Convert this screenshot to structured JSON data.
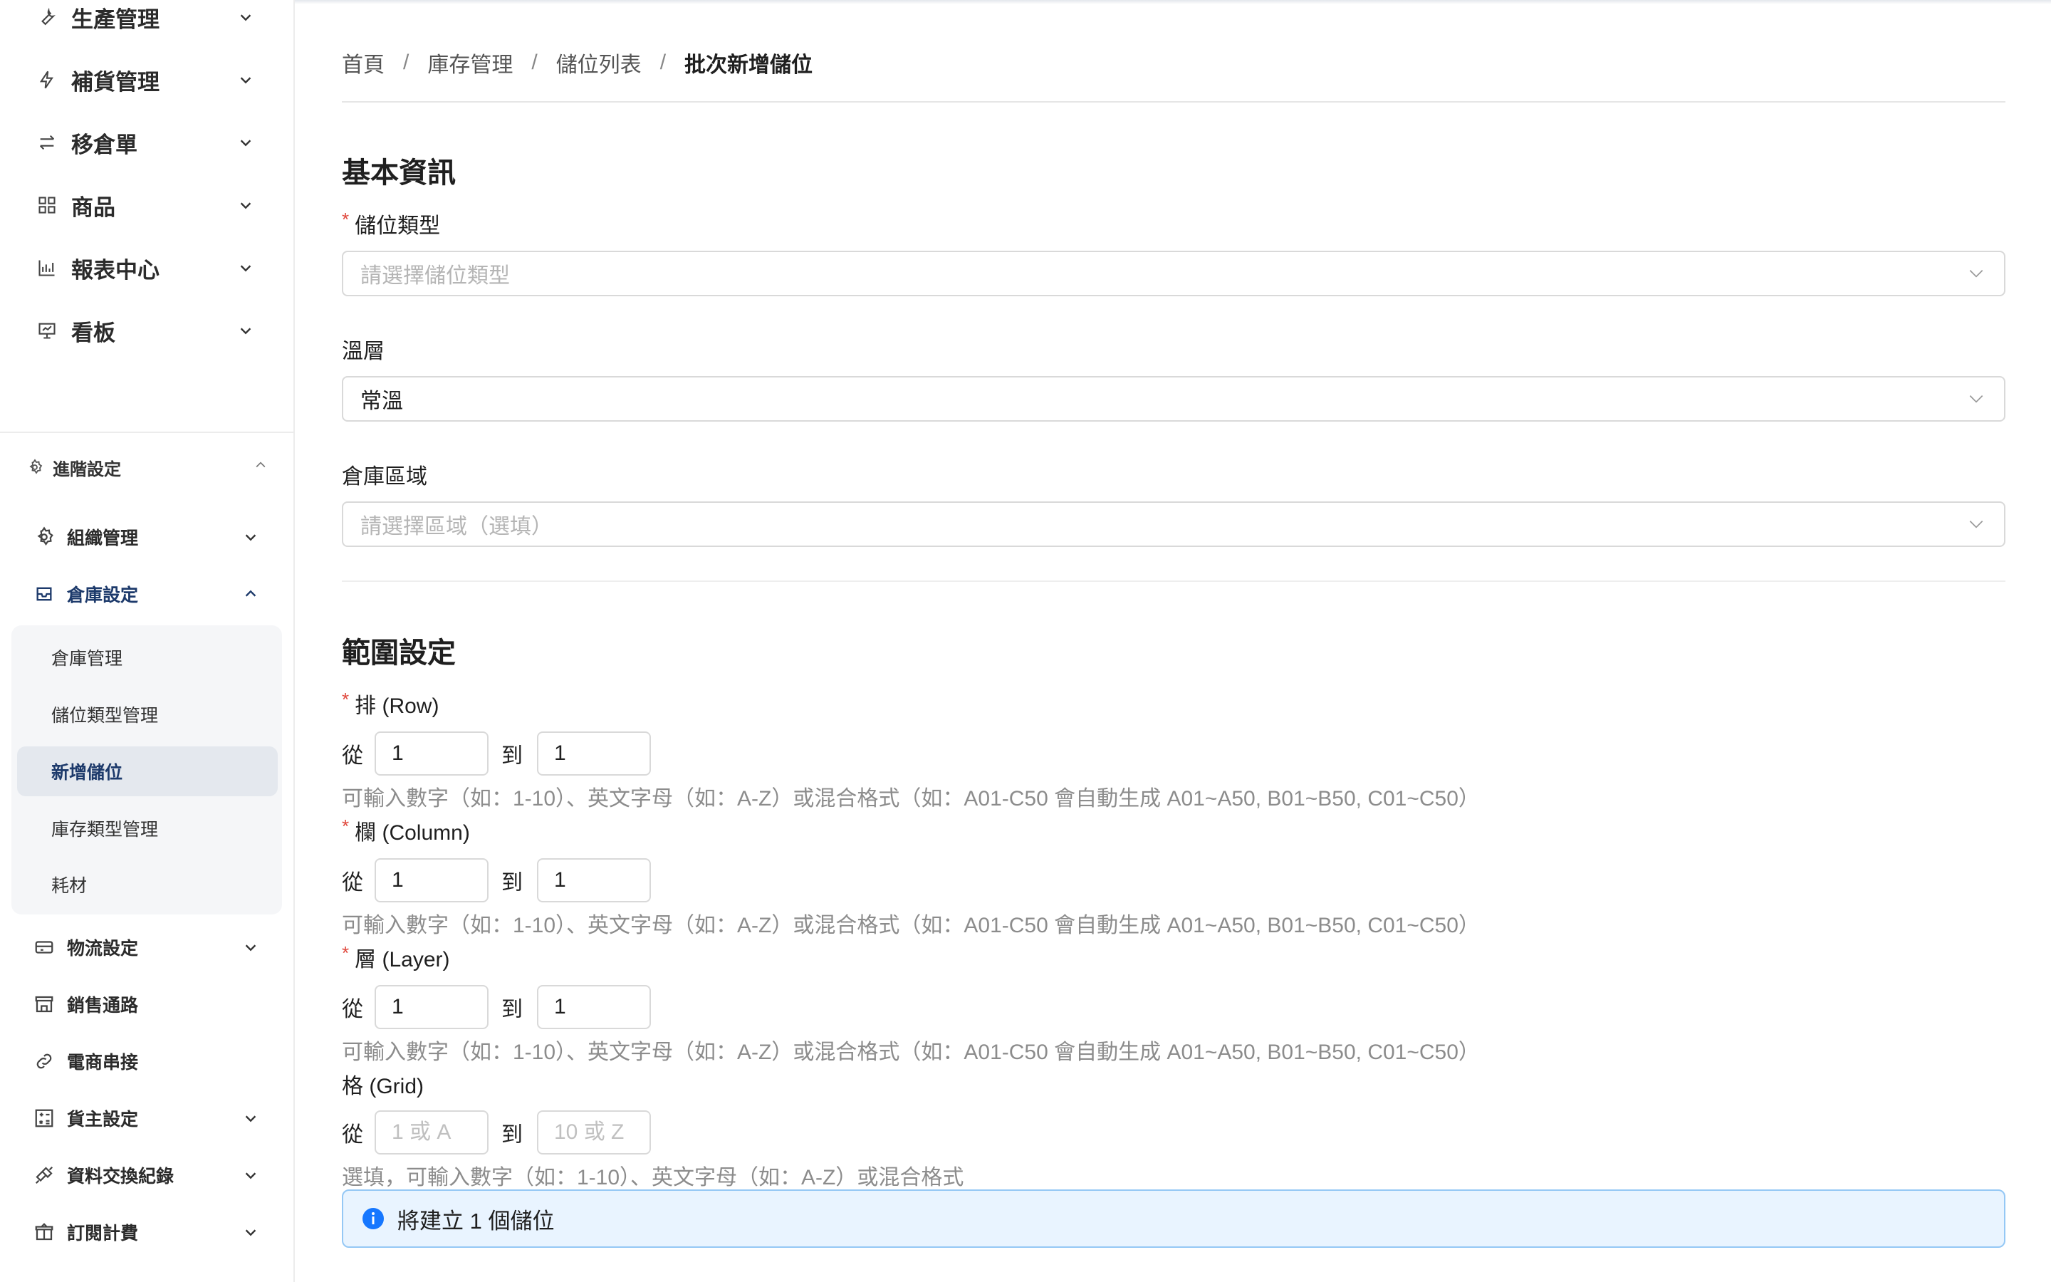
{
  "sidebar": {
    "top_items": [
      {
        "label": "生產管理",
        "icon": "wrench-icon"
      },
      {
        "label": "補貨管理",
        "icon": "lightning-icon"
      },
      {
        "label": "移倉單",
        "icon": "swap-icon"
      },
      {
        "label": "商品",
        "icon": "grid-icon"
      },
      {
        "label": "報表中心",
        "icon": "bar-chart-icon"
      },
      {
        "label": "看板",
        "icon": "presentation-icon"
      }
    ],
    "section": {
      "label": "進階設定",
      "icon": "gear-icon"
    },
    "section_items": [
      {
        "label": "組織管理",
        "icon": "gear-icon"
      },
      {
        "label": "倉庫設定",
        "icon": "inbox-icon"
      },
      {
        "label": "物流設定",
        "icon": "truck-icon"
      },
      {
        "label": "銷售通路",
        "icon": "shop-icon"
      },
      {
        "label": "電商串接",
        "icon": "link-icon"
      },
      {
        "label": "貨主設定",
        "icon": "calculator-icon"
      },
      {
        "label": "資料交換紀錄",
        "icon": "api-icon"
      },
      {
        "label": "訂閱計費",
        "icon": "gift-icon"
      }
    ],
    "warehouse_submenu": [
      {
        "label": "倉庫管理"
      },
      {
        "label": "儲位類型管理"
      },
      {
        "label": "新增儲位"
      },
      {
        "label": "庫存類型管理"
      },
      {
        "label": "耗材"
      }
    ]
  },
  "breadcrumb": {
    "items": [
      "首頁",
      "庫存管理",
      "儲位列表",
      "批次新增儲位"
    ],
    "separator": "/"
  },
  "basic_info": {
    "title": "基本資訊",
    "location_type": {
      "label": "儲位類型",
      "placeholder": "請選擇儲位類型"
    },
    "temperature": {
      "label": "溫層",
      "value": "常溫"
    },
    "zone": {
      "label": "倉庫區域",
      "placeholder": "請選擇區域（選填）"
    }
  },
  "range": {
    "title": "範圍設定",
    "from_label": "從",
    "to_label": "到",
    "hint": "可輸入數字（如：1-10）、英文字母（如：A-Z）或混合格式（如：A01-C50 會自動生成 A01~A50, B01~B50, C01~C50）",
    "row": {
      "label": "排 (Row)",
      "from": "1",
      "to": "1"
    },
    "column": {
      "label": "欄 (Column)",
      "from": "1",
      "to": "1"
    },
    "layer": {
      "label": "層 (Layer)",
      "from": "1",
      "to": "1"
    },
    "grid": {
      "label": "格 (Grid)",
      "from_placeholder": "1 或 A",
      "to_placeholder": "10 或 Z",
      "hint": "選填，可輸入數字（如：1-10）、英文字母（如：A-Z）或混合格式"
    }
  },
  "summary": {
    "text": "將建立 1 個儲位",
    "icon": "info-icon"
  },
  "colors": {
    "accent": "#1677ff",
    "required": "#e0493e",
    "info_bg": "#e9f4ff"
  }
}
